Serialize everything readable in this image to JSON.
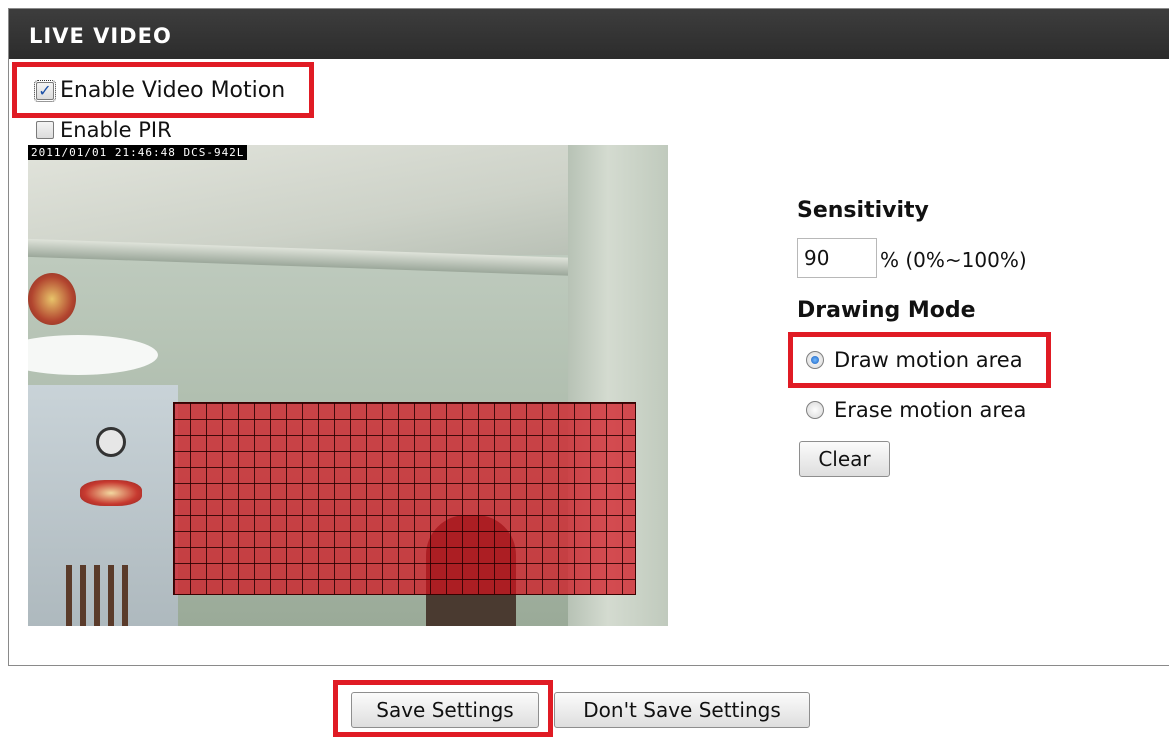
{
  "panel": {
    "title": "LIVE VIDEO"
  },
  "options": {
    "enable_video_motion": {
      "label": "Enable Video Motion",
      "checked": true
    },
    "enable_pir": {
      "label": "Enable PIR",
      "checked": false
    }
  },
  "video": {
    "timestamp": "2011/01/01 21:46:48 DCS-942L"
  },
  "sensitivity": {
    "heading": "Sensitivity",
    "value": "90",
    "range_text": "% (0%~100%)"
  },
  "drawing_mode": {
    "heading": "Drawing Mode",
    "draw_label": "Draw motion area",
    "erase_label": "Erase motion area",
    "selected": "draw",
    "clear_label": "Clear"
  },
  "footer": {
    "save_label": "Save Settings",
    "dont_save_label": "Don't Save Settings"
  },
  "colors": {
    "header_bg": "#2c2c2c",
    "highlight_red": "#e01b24",
    "motion_area": "#d2141e"
  }
}
